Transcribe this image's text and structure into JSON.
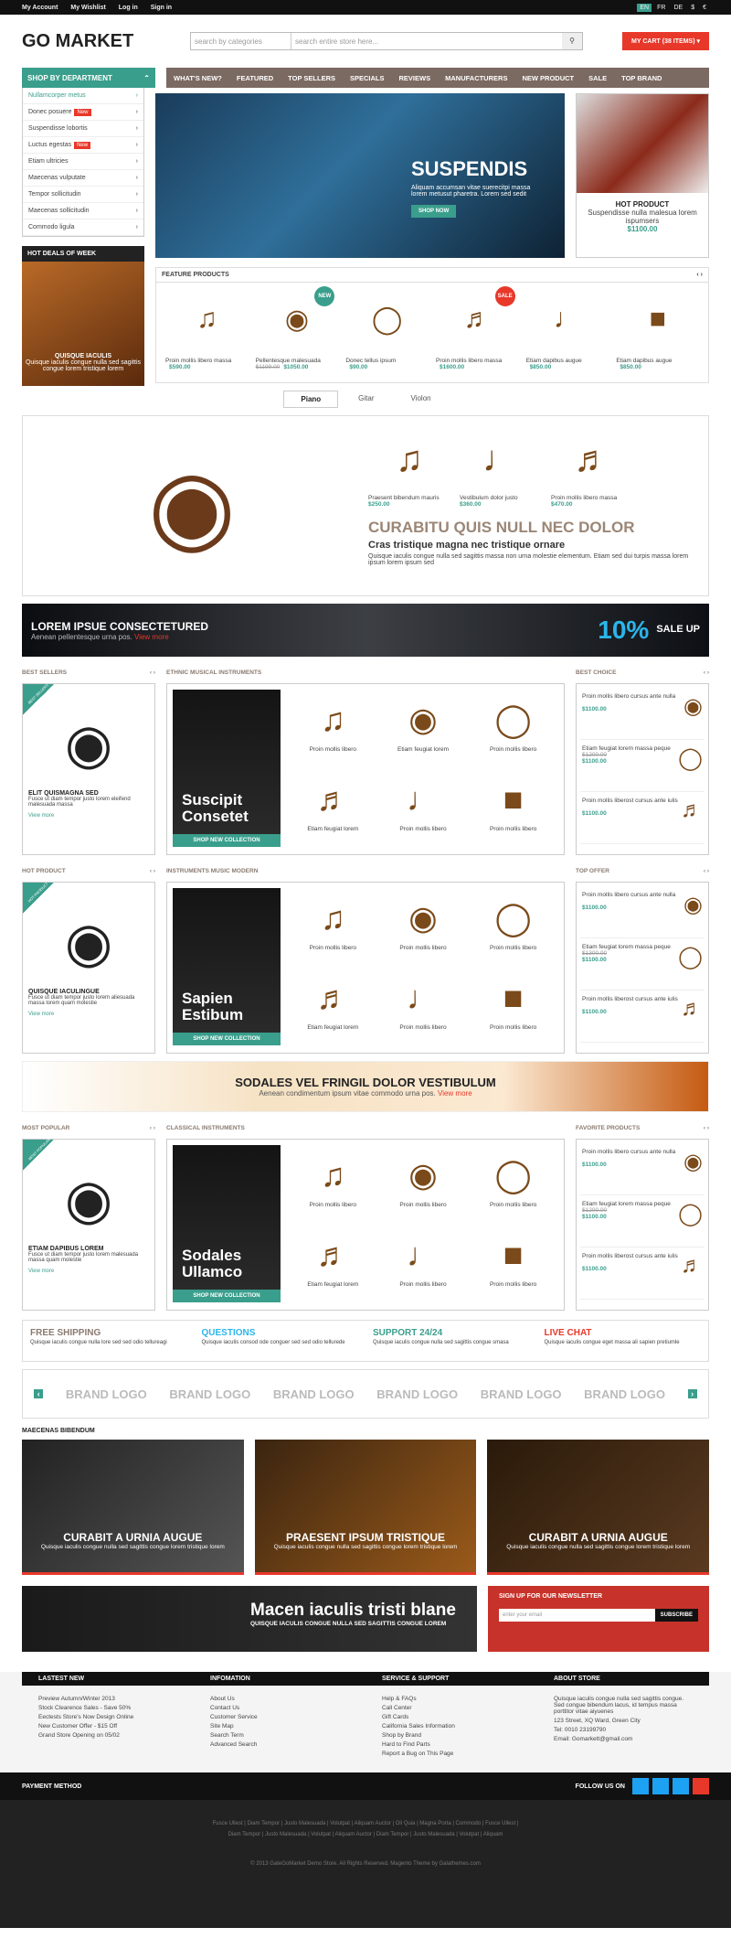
{
  "topbar": {
    "links": [
      "My Account",
      "My Wishlist",
      "Log in",
      "Sign in"
    ],
    "langs": [
      "EN",
      "FR",
      "DE",
      "$",
      "€"
    ]
  },
  "header": {
    "logo": "GO MARKET",
    "search_cat": "search by categories",
    "search_ph": "search entire store here...",
    "cart": "MY CART (38 ITEMS)"
  },
  "nav": {
    "dept": "SHOP BY DEPARTMENT",
    "menu": [
      "WHAT'S NEW?",
      "FEATURED",
      "TOP SELLERS",
      "SPECIALS",
      "REVIEWS",
      "MANUFACTURERS",
      "NEW PRODUCT",
      "SALE",
      "TOP BRAND"
    ]
  },
  "dept": [
    "Nullamcorper metus",
    "Donec posuere",
    "Suspendisse lobortis",
    "Luctus egestas",
    "Etiam ultricies",
    "Maecenas vulputate",
    "Tempor sollicitudin",
    "Maecenas sollicitudin",
    "Commodo ligula"
  ],
  "new_label": "New",
  "slider": {
    "title": "SUSPENDIS",
    "text": "Aliquam accumsan vitae suerecitpi massa lorem metusut pharetra. Lorem sed sedit",
    "btn": "SHOP NOW"
  },
  "hot_product": {
    "title": "HOT PRODUCT",
    "text": "Suspendisse nulla malesua lorem ispumsers",
    "price": "$1100.00"
  },
  "deals": {
    "title": "HOT DEALS OF WEEK",
    "name": "QUISQUE IACULIS",
    "text": "Quisque iaculis congue nulla sed sagittis congue lorem tristique lorem"
  },
  "featured": {
    "title": "FEATURE PRODUCTS",
    "items": [
      {
        "name": "Proin mollis libero massa",
        "price": "$590.00",
        "old": ""
      },
      {
        "name": "Pellentesque malesuada",
        "price": "$1050.00",
        "old": "$1199.00",
        "badge": "NEW"
      },
      {
        "name": "Donec tellus ipsum",
        "price": "$90.00",
        "old": ""
      },
      {
        "name": "Proin mollis libero massa",
        "price": "$1600.00",
        "old": "",
        "badge": "SALE"
      },
      {
        "name": "Etiam dapibus augue",
        "price": "$850.00",
        "old": ""
      },
      {
        "name": "Etiam dapibus augue",
        "price": "$850.00",
        "old": ""
      }
    ]
  },
  "tabs": [
    "Piano",
    "Gitar",
    "Violon"
  ],
  "drum": {
    "minis": [
      {
        "name": "Praesent bibendum mauris",
        "price": "$250.00"
      },
      {
        "name": "Vestibulum dolor justo",
        "price": "$360.00"
      },
      {
        "name": "Proin mollis libero massa",
        "price": "$470.00"
      }
    ],
    "h2": "CURABITU QUIS NULL NEC DOLOR",
    "h3": "Cras tristique magna nec tristique ornare",
    "p": "Quisque iaculis congue nulla sed sagittis massa non urna molestie elementum. Etiam sed dui turpis massa lorem ipsum lorem ipsum sed"
  },
  "banner1": {
    "title": "LOREM IPSUE CONSECTETURED",
    "sub": "Aenean pellentesque urna pos.",
    "vm": "View more",
    "pct": "10%",
    "sale": "SALE UP"
  },
  "sections": [
    {
      "left": {
        "label": "BEST SELLERS",
        "ribbon": "BEST SELLERS",
        "name": "ELIT QUISMAGNA SED",
        "text": "Fusce ut diam tempor justo lorem eleifend malesuada massa"
      },
      "mid": {
        "label": "ETHNIC MUSICAL INSTRUMENTS",
        "dark": "Suscipit Consetet",
        "cells": [
          "Proin mollis libero",
          "Etiam feugiat lorem",
          "Proin mollis libero",
          "Etiam feugiat lorem",
          "Proin mollis libero",
          "Proin mollis libero"
        ]
      },
      "right": {
        "label": "BEST CHOICE",
        "items": [
          {
            "name": "Proin mollis libero cursus ante nulla",
            "price": "$1100.00",
            "old": ""
          },
          {
            "name": "Etiam feugiat lorem massa peque",
            "price": "$1100.00",
            "old": "$1200.00"
          },
          {
            "name": "Proin mollis liberost cursus ante iulis",
            "price": "$1100.00",
            "old": ""
          }
        ]
      }
    },
    {
      "left": {
        "label": "HOT PRODUCT",
        "ribbon": "HOT PRODUCT",
        "name": "QUISQUE IACULINGUE",
        "text": "Fusce ut diam tempor justo lorem aliesuada massa lorem quam molestie"
      },
      "mid": {
        "label": "INSTRUMENTS MUSIC MODERN",
        "dark": "Sapien Estibum",
        "cells": [
          "Proin mollis libero",
          "Proin mollis libero",
          "Proin mollis libero",
          "Etiam feugiat lorem",
          "Proin mollis libero",
          "Proin mollis libero"
        ]
      },
      "right": {
        "label": "TOP OFFER",
        "items": [
          {
            "name": "Proin mollis libero cursus ante nulla",
            "price": "$1100.00",
            "old": ""
          },
          {
            "name": "Etiam feugiat lorem massa peque",
            "price": "$1100.00",
            "old": "$1300.00"
          },
          {
            "name": "Proin mollis liberost cursus ante iulis",
            "price": "$1100.00",
            "old": ""
          }
        ]
      }
    }
  ],
  "banner2": {
    "title": "SODALES VEL FRINGIL DOLOR VESTIBULUM",
    "sub": "Aenean condimentum ipsum vitae commodo urna pos.",
    "vm": "View more"
  },
  "section3": {
    "left": {
      "label": "MOST POPULAR",
      "ribbon": "MOST POPULAR",
      "name": "ETIAM DAPIBUS LOREM",
      "text": "Fusce ut diam tempor justo lorem malesuada massa quam molestie"
    },
    "mid": {
      "label": "CLASSICAL INSTRUMENTS",
      "dark": "Sodales Ullamco",
      "cells": [
        "Proin mollis libero",
        "Proin mollis libero",
        "Proin mollis libero",
        "Etiam feugiat lorem",
        "Proin mollis libero",
        "Proin mollis libero"
      ]
    },
    "right": {
      "label": "FAVORITE PRODUCTS",
      "items": [
        {
          "name": "Proin mollis libero cursus ante nulla",
          "price": "$1100.00",
          "old": ""
        },
        {
          "name": "Etiam feugiat lorem massa peque",
          "price": "$1100.00",
          "old": "$1200.00"
        },
        {
          "name": "Proin mollis liberost cursus ante iulis",
          "price": "$1100.00",
          "old": ""
        }
      ]
    }
  },
  "collection_btn": "SHOP NEW COLLECTION",
  "view_more": "View more",
  "services": [
    {
      "t": "FREE SHIPPING",
      "c": "#8a7a70",
      "d": "Quisque iaculis congue nulla lore sed sed odio tellureagi"
    },
    {
      "t": "QUESTIONS",
      "c": "#2bb5ea",
      "d": "Quisque iaculis consod ode conguer sed sed odio tellurede"
    },
    {
      "t": "SUPPORT 24/24",
      "c": "#3a9e8c",
      "d": "Quisque iaculis congue nulla sed sagittis congue smasa"
    },
    {
      "t": "LIVE CHAT",
      "c": "#e8382a",
      "d": "Quisque iaculis congue eget massa ali sapien pretiumle"
    }
  ],
  "brand": "BRAND LOGO",
  "maecenas": {
    "title": "MAECENAS BIBENDUM",
    "boxes": [
      {
        "t": "CURABIT A URNIA AUGUE",
        "d": "Quisque iaculis congue nulla sed sagittis congue lorem tristique lorem"
      },
      {
        "t": "PRAESENT IPSUM TRISTIQUE",
        "d": "Quisque iaculis congue nulla sed sagittis congue lorem tristique lorem"
      },
      {
        "t": "CURABIT A URNIA AUGUE",
        "d": "Quisque iaculis congue nulla sed sagittis congue lorem tristique lorem"
      }
    ]
  },
  "sax": {
    "t": "Macen iaculis tristi blane",
    "d": "QUISQUE IACULIS CONGUE NULLA SED SAGITTIS CONGUE LOREM"
  },
  "newsletter": {
    "t": "SIGN UP FOR OUR NEWSLETTER",
    "ph": "enter your email",
    "btn": "SUBSCRIBE"
  },
  "footer": {
    "heads": [
      "LASTEST NEW",
      "INFOMATION",
      "SERVICE & SUPPORT",
      "ABOUT STORE"
    ],
    "c1": [
      "Preview Autumn/Winter 2013",
      "Stock Clearence Sales - Save 50%",
      "Eectests Store's Now Design Online",
      "New Customer Offer - $15 Off",
      "Grand Store Opening on 05/02"
    ],
    "c2": [
      "About Us",
      "Contact Us",
      "Customer Service",
      "Site Map",
      "Search Term",
      "Advanced Search"
    ],
    "c3": [
      "Help & FAQs",
      "Call Center",
      "Gift Cards",
      "California Sales Information",
      "Shop by Brand",
      "Hard to Find Parts",
      "Report a Bug on This Page"
    ],
    "c4": [
      "Quisque iaculis congue nulla sed sagittis congue. Sed congue bibendum lacus, id tempus massa porttitor vitae aiyuenes",
      "123 Street, XQ Ward, Green City",
      "Tel: 0010 23199790",
      "Email: Gomarkett@gmail.com"
    ]
  },
  "payment": "PAYMENT METHOD",
  "follow": "FOLLOW US ON",
  "links": "Fusce Ullest | Diam Tempor | Justo Malesuada | Volutpat | Aliquam Auctor | Oil Quia | Magna Porta | Commodo | Fusce Ullest | Diam Tempor | Justo Malesuada | Volutpat | Aliquam Auctor | Diam Tempor | Justo Malesuada | Volutpat | Aliquam",
  "copyright": "© 2013 GateGoMarket Demo Store. All Rights Reserved. Magento Theme by Galathemes.com"
}
